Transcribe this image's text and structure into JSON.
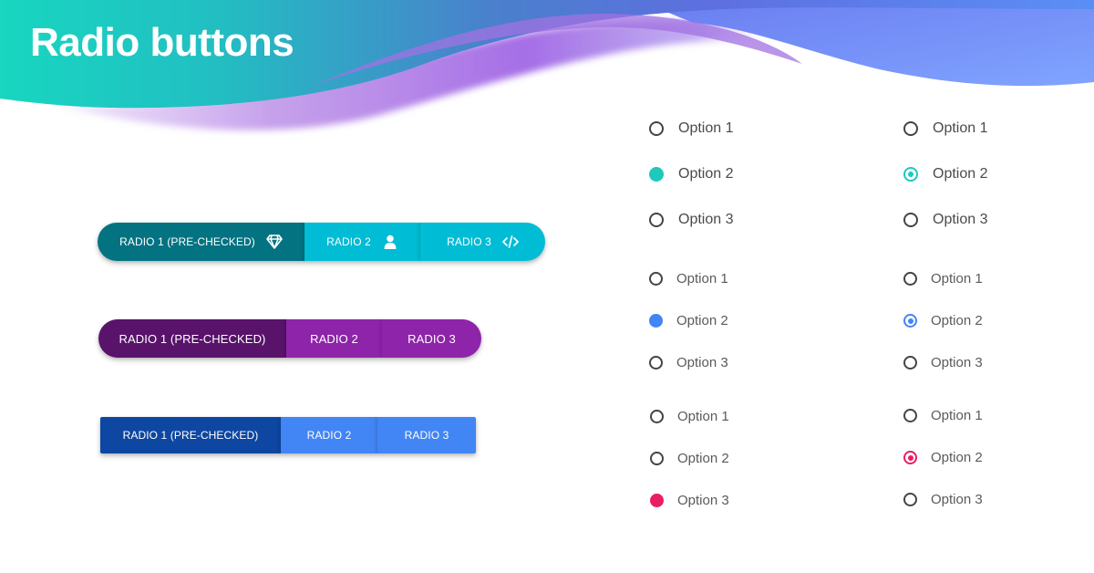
{
  "title": "Radio buttons",
  "colors": {
    "teal_dark": "#037382",
    "teal": "#00bcd4",
    "teal_check": "#1ec8bd",
    "purple_dark": "#59136b",
    "purple": "#8e24aa",
    "blue_dark": "#0d47a1",
    "blue": "#4285f4",
    "pink": "#e91e63",
    "unchecked_border": "#444444"
  },
  "button_groups": [
    {
      "style": "teal-rounded",
      "buttons": [
        {
          "label": "RADIO 1 (PRE-CHECKED)",
          "icon": "diamond-icon",
          "checked": true
        },
        {
          "label": "RADIO 2",
          "icon": "user-icon",
          "checked": false
        },
        {
          "label": "RADIO 3",
          "icon": "code-icon",
          "checked": false
        }
      ]
    },
    {
      "style": "purple-rounded",
      "buttons": [
        {
          "label": "RADIO 1 (PRE-CHECKED)",
          "checked": true
        },
        {
          "label": "RADIO 2",
          "checked": false
        },
        {
          "label": "RADIO 3",
          "checked": false
        }
      ]
    },
    {
      "style": "blue-square",
      "buttons": [
        {
          "label": "RADIO 1 (PRE-CHECKED)",
          "checked": true
        },
        {
          "label": "RADIO 2",
          "checked": false
        },
        {
          "label": "RADIO 3",
          "checked": false
        }
      ]
    }
  ],
  "radio_groups": [
    {
      "name": "teal-filled",
      "color": "#1ec8bd",
      "variant": "filled",
      "options": [
        "Option 1",
        "Option 2",
        "Option 3"
      ],
      "selected": 1
    },
    {
      "name": "teal-ring",
      "color": "#1ec8bd",
      "variant": "ring",
      "options": [
        "Option 1",
        "Option 2",
        "Option 3"
      ],
      "selected": 1
    },
    {
      "name": "blue-filled",
      "color": "#4285f4",
      "variant": "filled",
      "options": [
        "Option 1",
        "Option 2",
        "Option 3"
      ],
      "selected": 1
    },
    {
      "name": "blue-ring",
      "color": "#4285f4",
      "variant": "ring",
      "options": [
        "Option 1",
        "Option 2",
        "Option 3"
      ],
      "selected": 1
    },
    {
      "name": "pink-filled",
      "color": "#e91e63",
      "variant": "filled",
      "options": [
        "Option 1",
        "Option 2",
        "Option 3"
      ],
      "selected": 2
    },
    {
      "name": "pink-ring",
      "color": "#e91e63",
      "variant": "ring",
      "options": [
        "Option 1",
        "Option 2",
        "Option 3"
      ],
      "selected": 1
    }
  ]
}
